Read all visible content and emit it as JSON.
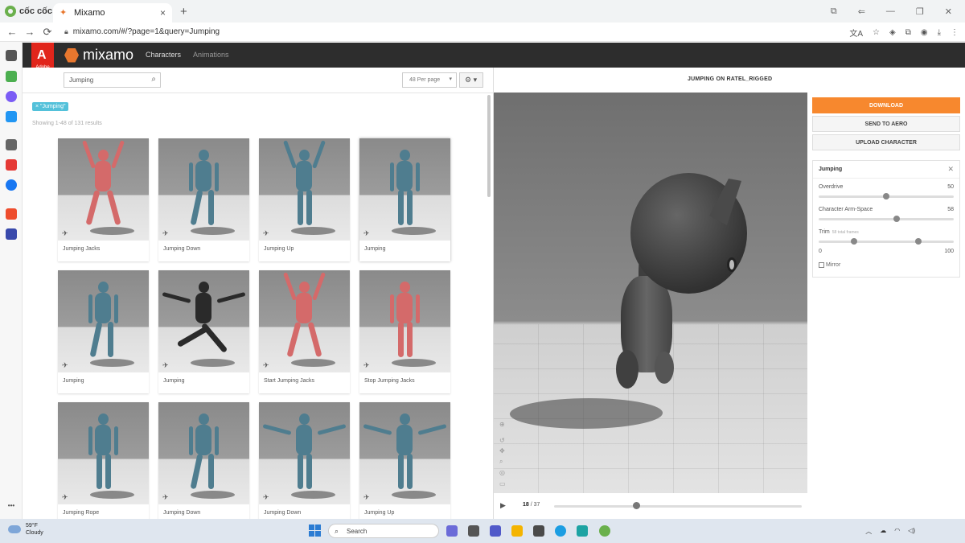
{
  "browser": {
    "brand": "cốc cốc",
    "tab_title": "Mixamo",
    "tab_close": "×",
    "new_tab": "+",
    "url": "mixamo.com/#/?page=1&query=Jumping",
    "nav": {
      "back": "←",
      "forward": "→",
      "reload": "⟳"
    },
    "window_controls": [
      "⧉",
      "⇐",
      "—",
      "❐",
      "✕"
    ],
    "toolbar_icons": [
      "文A",
      "☆",
      "◈",
      "⧉",
      "◉",
      "⤓",
      "⋮"
    ]
  },
  "mixamo": {
    "adobe_label": "Adobe",
    "logo": "mixamo",
    "nav": {
      "characters": "Characters",
      "animations": "Animations"
    }
  },
  "toolbar": {
    "search_value": "Jumping",
    "per_page": "48 Per page",
    "gear": "⚙ ▾"
  },
  "filter_tag": "× \"Jumping\"",
  "results_text": "Showing 1-48 of 131 results",
  "cards": [
    {
      "label": "Jumping Jacks",
      "color": "#d46a6a"
    },
    {
      "label": "Jumping Down",
      "color": "#4f7d8f"
    },
    {
      "label": "Jumping Up",
      "color": "#4f7d8f"
    },
    {
      "label": "Jumping",
      "color": "#4f7d8f"
    },
    {
      "label": "Jumping",
      "color": "#4f7d8f"
    },
    {
      "label": "Jumping",
      "color": "#2a2a2a"
    },
    {
      "label": "Start Jumping Jacks",
      "color": "#d46a6a"
    },
    {
      "label": "Stop Jumping Jacks",
      "color": "#d46a6a"
    },
    {
      "label": "Jumping Rope",
      "color": "#4f7d8f"
    },
    {
      "label": "Jumping Down",
      "color": "#4f7d8f"
    },
    {
      "label": "Jumping Down",
      "color": "#4f7d8f"
    },
    {
      "label": "Jumping Up",
      "color": "#4f7d8f"
    }
  ],
  "viewer": {
    "title": "JUMPING ON RATEL_RIGGED",
    "frame_current": "18",
    "frame_total": "/ 37",
    "progress": 0.33
  },
  "actions": {
    "download": "DOWNLOAD",
    "send_aero": "SEND TO AERO",
    "upload": "UPLOAD CHARACTER"
  },
  "settings": {
    "title": "Jumping",
    "close": "✕",
    "overdrive_label": "Overdrive",
    "overdrive_value": "50",
    "armspace_label": "Character Arm-Space",
    "armspace_value": "58",
    "trim_label": "Trim",
    "trim_sub": "58 total frames",
    "trim_min": "0",
    "trim_max": "100",
    "mirror_label": "Mirror"
  },
  "taskbar": {
    "temp": "59°F",
    "condition": "Cloudy",
    "search": "Search"
  },
  "colors": {
    "accent": "#f7882e",
    "tag": "#53c1da",
    "header": "#2d2d2d",
    "adobe": "#e1251b"
  }
}
